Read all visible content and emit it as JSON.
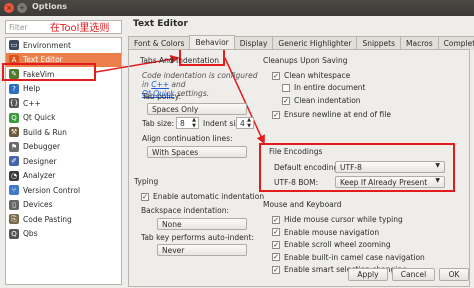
{
  "window": {
    "title": "Options",
    "close_glyph": "×",
    "max_glyph": "+"
  },
  "sidebar": {
    "filter_placeholder": "Filter",
    "annotation": "在Tool里选则",
    "items": [
      {
        "label": "Environment",
        "icon": "monitor-icon",
        "glyph": "▭",
        "color": "#3b4a5a"
      },
      {
        "label": "Text Editor",
        "icon": "text-editor-icon",
        "glyph": "A",
        "color": "#d9531e"
      },
      {
        "label": "FakeVim",
        "icon": "fakevim-icon",
        "glyph": "✎",
        "color": "#4f7b2d"
      },
      {
        "label": "Help",
        "icon": "help-icon",
        "glyph": "?",
        "color": "#2d6fc2"
      },
      {
        "label": "C++",
        "icon": "cpp-icon",
        "glyph": "{}",
        "color": "#555555"
      },
      {
        "label": "Qt Quick",
        "icon": "qt-quick-icon",
        "glyph": "Q",
        "color": "#3d9b3d"
      },
      {
        "label": "Build & Run",
        "icon": "build-run-icon",
        "glyph": "⚒",
        "color": "#6e5b3e"
      },
      {
        "label": "Debugger",
        "icon": "debugger-icon",
        "glyph": "⚑",
        "color": "#6a6a6a"
      },
      {
        "label": "Designer",
        "icon": "designer-icon",
        "glyph": "✐",
        "color": "#4563a8"
      },
      {
        "label": "Analyzer",
        "icon": "analyzer-icon",
        "glyph": "◔",
        "color": "#3b3b3b"
      },
      {
        "label": "Version Control",
        "icon": "version-control-icon",
        "glyph": "⑂",
        "color": "#3f7ac9"
      },
      {
        "label": "Devices",
        "icon": "devices-icon",
        "glyph": "▯",
        "color": "#666666"
      },
      {
        "label": "Code Pasting",
        "icon": "code-pasting-icon",
        "glyph": "⎘",
        "color": "#7a6a4b"
      },
      {
        "label": "Qbs",
        "icon": "qbs-icon",
        "glyph": "Q",
        "color": "#555555"
      }
    ]
  },
  "panel": {
    "title": "Text Editor",
    "tabs": [
      "Font & Colors",
      "Behavior",
      "Display",
      "Generic Highlighter",
      "Snippets",
      "Macros",
      "Completion"
    ],
    "active_tab": 1
  },
  "tabs_indentation": {
    "heading": "Tabs And Indentation",
    "note_prefix": "Code indentation is configured in ",
    "link_cpp": "C++",
    "note_and": " and",
    "link_qtquick": "Qt Quick",
    "note_suffix": " settings.",
    "tab_policy_label": "Tab policy:",
    "tab_policy_value": "Spaces Only",
    "tab_size_label": "Tab size:",
    "tab_size_value": "8",
    "indent_size_label": "Indent size:",
    "indent_size_value": "4",
    "align_label": "Align continuation lines:",
    "align_value": "With Spaces"
  },
  "typing": {
    "heading": "Typing",
    "auto_indent": "Enable automatic indentation",
    "backspace_label": "Backspace indentation:",
    "backspace_value": "None",
    "tab_key_label": "Tab key performs auto-indent:",
    "tab_key_value": "Never"
  },
  "cleanups": {
    "heading": "Cleanups Upon Saving",
    "clean_whitespace": "Clean whitespace",
    "in_entire_document": "In entire document",
    "clean_indentation": "Clean indentation",
    "ensure_newline": "Ensure newline at end of file"
  },
  "file_encodings": {
    "heading": "File Encodings",
    "default_label": "Default encoding:",
    "default_value": "UTF-8",
    "bom_label": "UTF-8 BOM:",
    "bom_value": "Keep If Already Present"
  },
  "mouse_keyboard": {
    "heading": "Mouse and Keyboard",
    "items": [
      "Hide mouse cursor while typing",
      "Enable mouse navigation",
      "Enable scroll wheel zooming",
      "Enable built-in camel case navigation",
      "Enable smart selection changing"
    ]
  },
  "footer": {
    "apply": "Apply",
    "cancel": "Cancel",
    "ok": "OK"
  },
  "glyphs": {
    "check": "✓",
    "dropdown": "▼",
    "spin_up": "▲",
    "spin_down": "▼"
  },
  "colors": {
    "selection": "#ea7f4c",
    "annotation_red": "#e21d1d",
    "link": "#1d5ed8"
  }
}
